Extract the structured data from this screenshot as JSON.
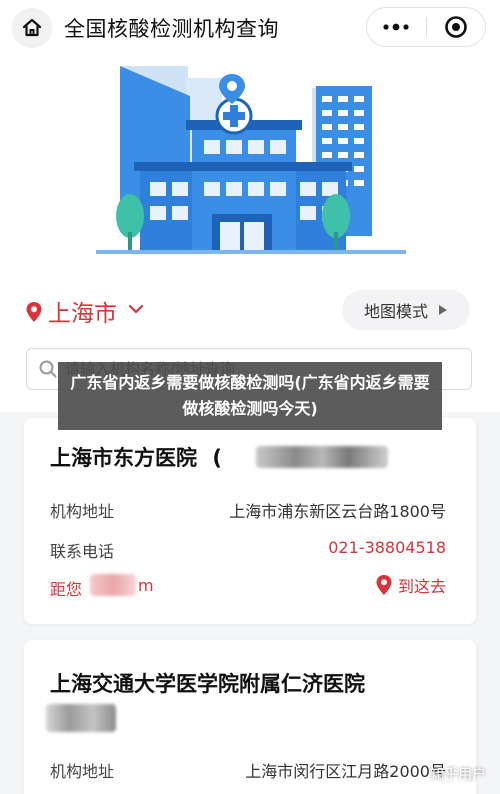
{
  "header": {
    "title": "全国核酸检测机构查询",
    "home_icon": "home-icon",
    "more_icon": "more-dots-icon",
    "close_icon": "target-close-icon"
  },
  "city_bar": {
    "city": "上海市",
    "map_mode_label": "地图模式"
  },
  "search": {
    "placeholder": "请输入机构名称/地址查询"
  },
  "overlay": {
    "caption": "广东省内返乡需要做核酸检测吗(广东省内返乡需要做核酸检测吗今天)"
  },
  "institutions": [
    {
      "name": "上海市东方医院",
      "name_suffix": "(",
      "address_label": "机构地址",
      "address": "上海市浦东新区云台路1800号",
      "phone_label": "联系电话",
      "phone": "021-38804518",
      "distance_label": "距您",
      "distance_unit": "m",
      "go_label": "到这去"
    },
    {
      "name": "上海交通大学医学院附属仁济医院",
      "address_label": "机构地址",
      "address": "上海市闵行区江月路2000号"
    }
  ],
  "watermark": "知乎用户",
  "colors": {
    "accent": "#d8343a",
    "building": "#3a8ee6",
    "background": "#f4f5f7"
  }
}
